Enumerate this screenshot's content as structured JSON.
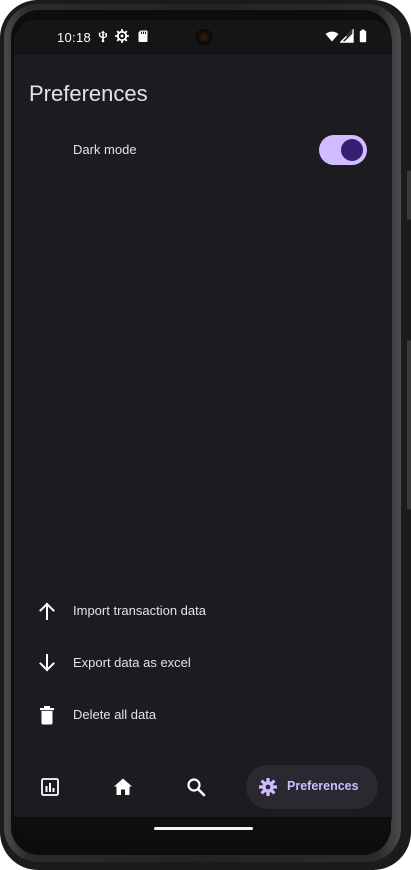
{
  "status_bar": {
    "time": "10:18",
    "left_icons": [
      "usb-debug-icon",
      "settings-gear-icon",
      "sd-card-icon"
    ],
    "right_icons": [
      "wifi-icon",
      "signal-icon",
      "battery-icon"
    ]
  },
  "page": {
    "title": "Preferences"
  },
  "settings": {
    "dark_mode": {
      "label": "Dark mode",
      "icon": "moon-icon",
      "enabled": true
    }
  },
  "actions": [
    {
      "label": "Import transaction data",
      "icon": "arrow-up-icon"
    },
    {
      "label": "Export data as excel",
      "icon": "arrow-down-icon"
    },
    {
      "label": "Delete all data",
      "icon": "trash-icon"
    }
  ],
  "navigation": {
    "items": [
      {
        "name": "analytics",
        "icon": "chart-icon"
      },
      {
        "name": "home",
        "icon": "home-icon"
      },
      {
        "name": "search",
        "icon": "search-icon"
      },
      {
        "name": "preferences",
        "icon": "gear-icon",
        "label": "Preferences",
        "active": true
      }
    ]
  },
  "colors": {
    "background": "#1c1b1f",
    "accent": "#d0bcff",
    "accent_dark": "#381e72",
    "text": "#e6e1e5"
  }
}
